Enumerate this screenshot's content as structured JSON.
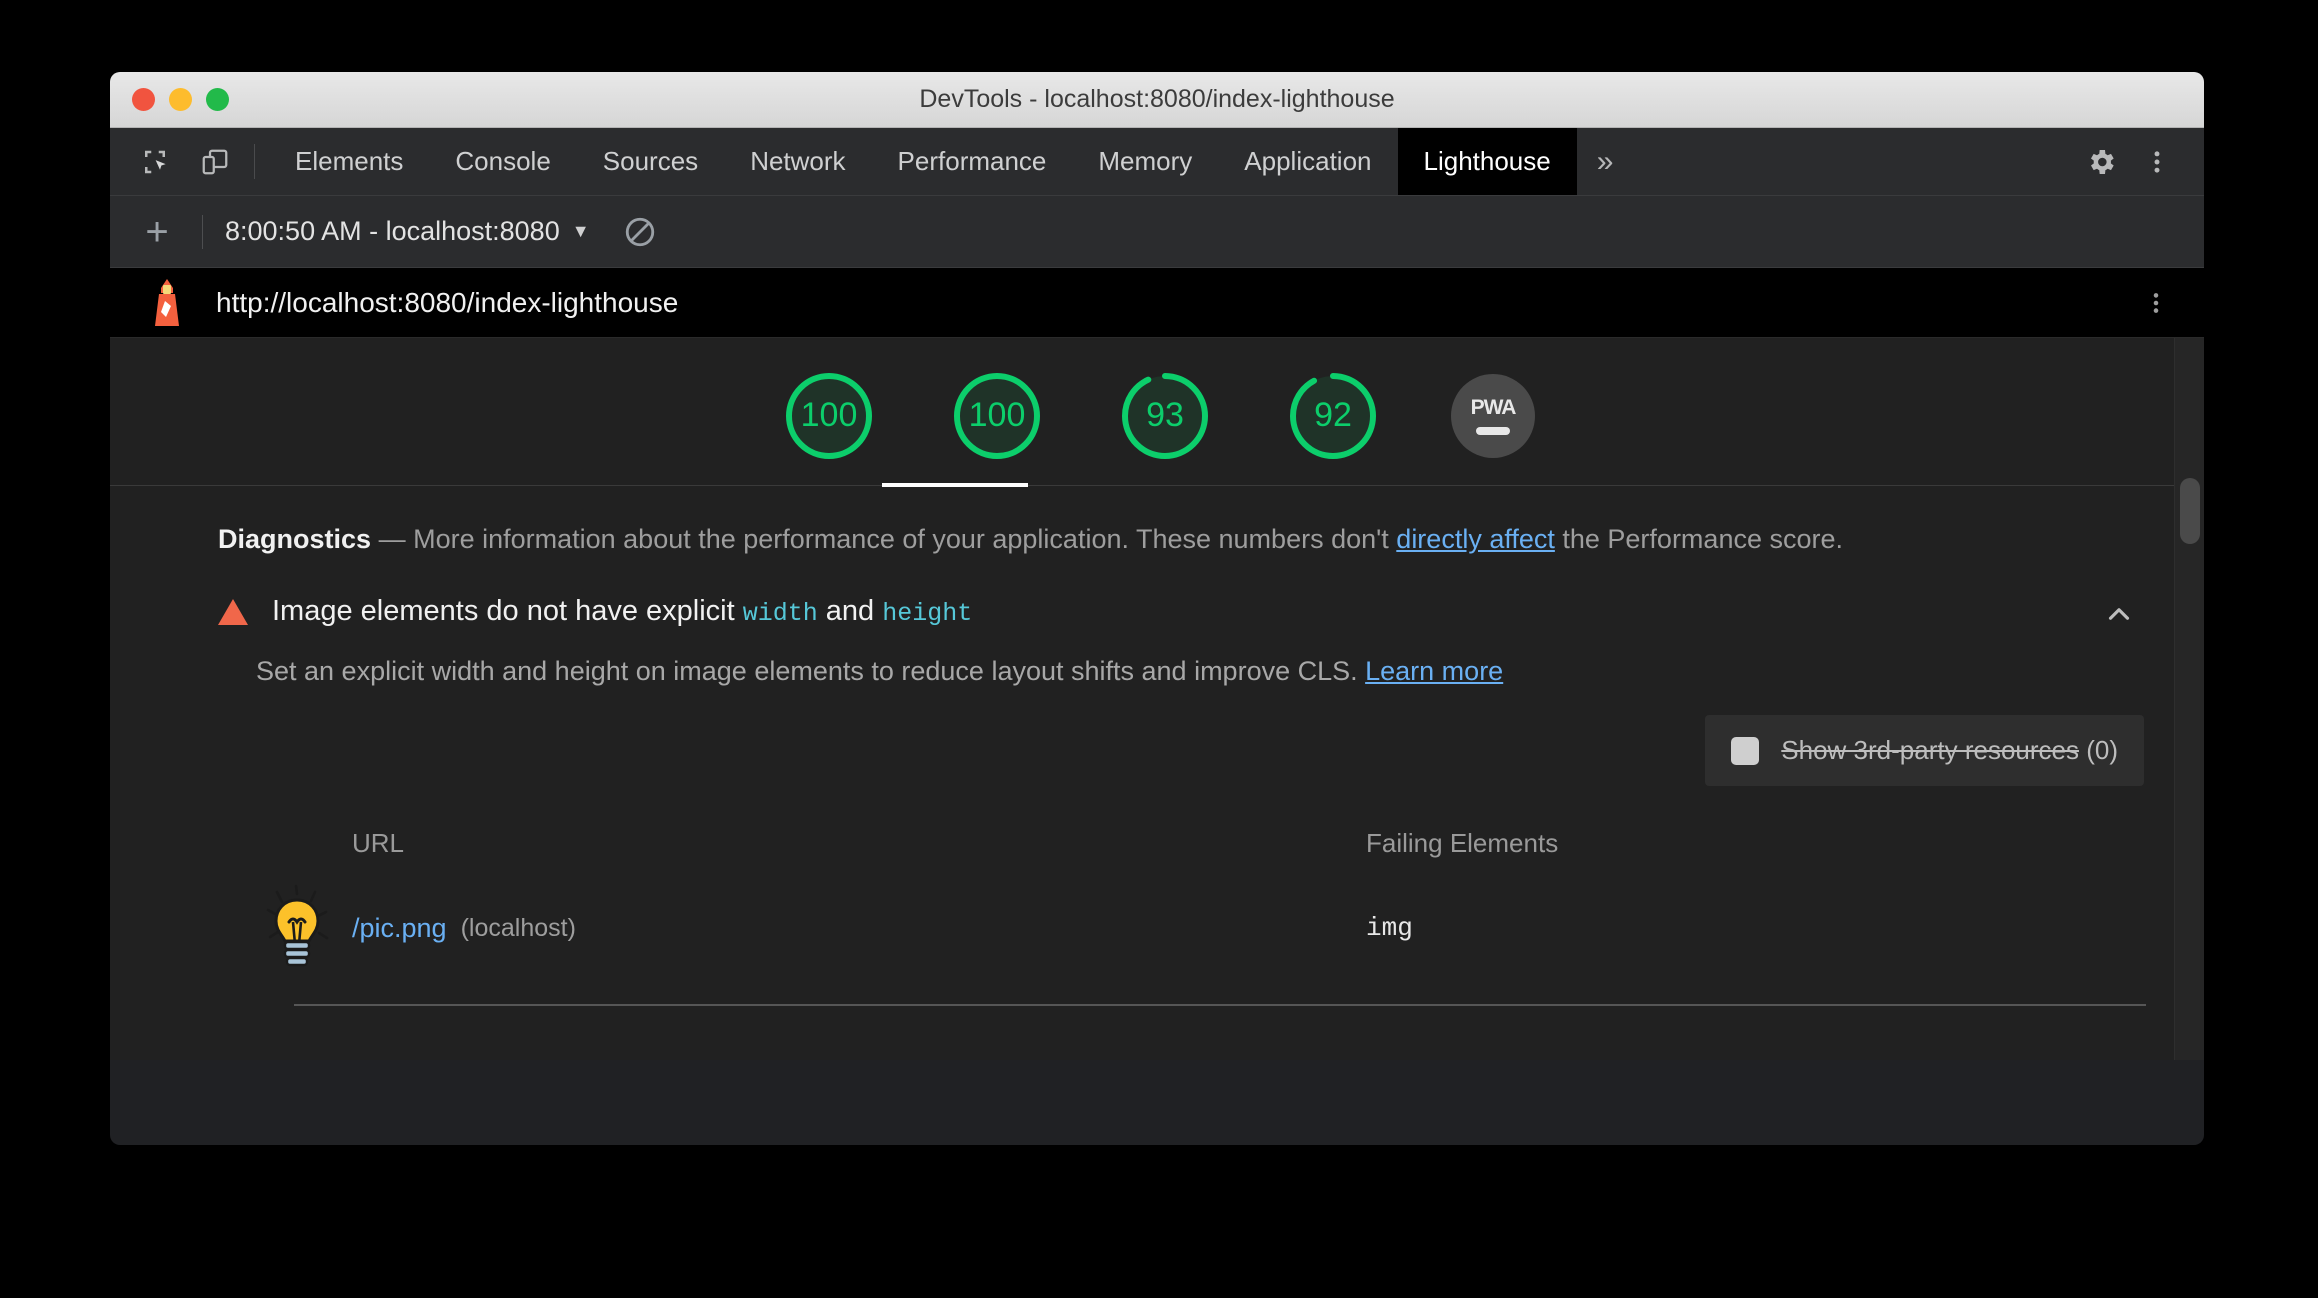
{
  "window": {
    "title": "DevTools - localhost:8080/index-lighthouse",
    "traffic_lights": [
      "close",
      "minimize",
      "maximize"
    ]
  },
  "devtools": {
    "left_icons": [
      {
        "name": "inspect-element-icon",
        "label": "Inspect element"
      },
      {
        "name": "device-toolbar-icon",
        "label": "Toggle device toolbar"
      }
    ],
    "tabs": [
      {
        "label": "Elements",
        "active": false
      },
      {
        "label": "Console",
        "active": false
      },
      {
        "label": "Sources",
        "active": false
      },
      {
        "label": "Network",
        "active": false
      },
      {
        "label": "Performance",
        "active": false
      },
      {
        "label": "Memory",
        "active": false
      },
      {
        "label": "Application",
        "active": false
      },
      {
        "label": "Lighthouse",
        "active": true
      }
    ],
    "more_tabs_label": "»",
    "right_icons": [
      {
        "name": "settings-gear-icon",
        "label": "Settings"
      },
      {
        "name": "more-options-kebab-icon",
        "label": "Customize and control DevTools"
      }
    ]
  },
  "lighthouse_toolbar": {
    "new_report_label": "+",
    "run_selector_label": "8:00:50 AM - localhost:8080",
    "run_selector_caret": "▼",
    "clear_label": "Clear all"
  },
  "report_header": {
    "url": "http://localhost:8080/index-lighthouse",
    "logo_name": "lighthouse-logo-icon",
    "menu_label": "Report options"
  },
  "scores": {
    "gauges": [
      {
        "value": "100",
        "score": 100,
        "selected": true
      },
      {
        "value": "100",
        "score": 100,
        "selected": false
      },
      {
        "value": "93",
        "score": 93,
        "selected": false
      },
      {
        "value": "92",
        "score": 92,
        "selected": false
      }
    ],
    "pwa": {
      "label": "PWA",
      "state": "null"
    },
    "pass_color": "#0cce6b",
    "track_color": "#1f3328",
    "pwa_bg": "#4a4a4a"
  },
  "diagnostics": {
    "title": "Diagnostics",
    "dash": "—",
    "text_before_link": "More information about the performance of your application. These numbers don't ",
    "link_text": "directly affect",
    "text_after_link": " the Performance score."
  },
  "audit": {
    "severity_icon": "warning-triangle-icon",
    "severity_color": "#f0674a",
    "title_part1": "Image elements do not have explicit ",
    "title_code1": "width",
    "title_part2": " and ",
    "title_code2": "height",
    "collapse_icon": "chevron-up-icon",
    "description_text": "Set an explicit width and height on image elements to reduce layout shifts and improve CLS. ",
    "description_link": "Learn more",
    "third_party": {
      "label_struck": "Show 3rd-party resources",
      "count": "(0)",
      "checked": false
    },
    "table": {
      "columns": [
        "URL",
        "Failing Elements"
      ],
      "rows": [
        {
          "thumbnail": "lightbulb-thumbnail",
          "url": "/pic.png",
          "host": "(localhost)",
          "failing_element": "img"
        }
      ]
    }
  }
}
